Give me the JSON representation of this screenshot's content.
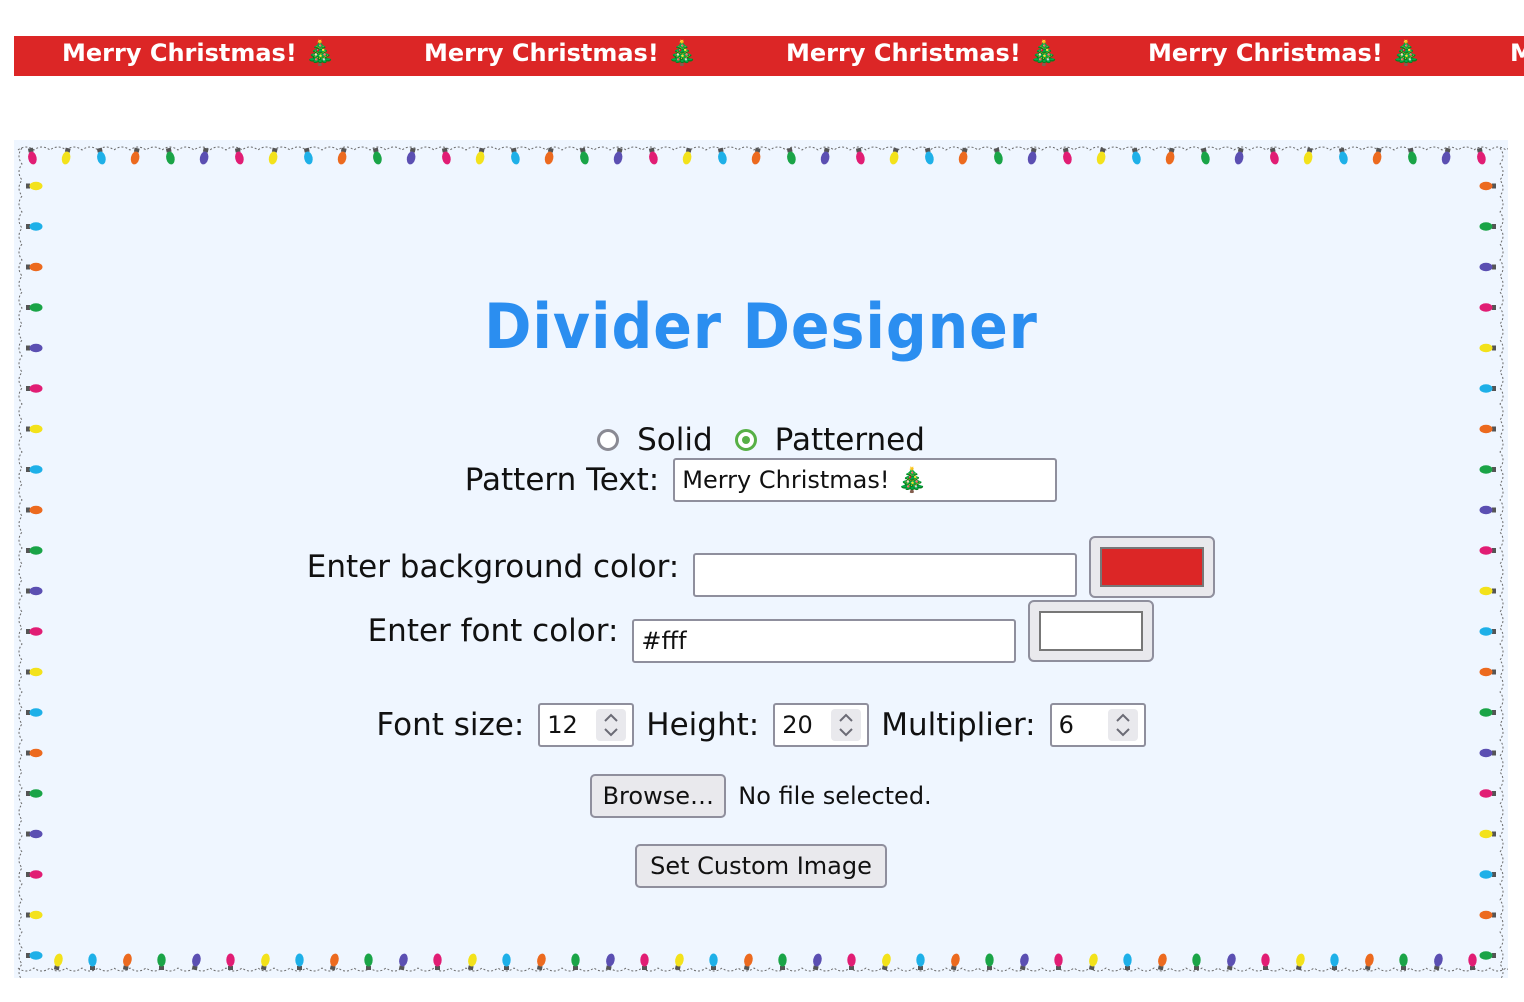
{
  "banner": {
    "text": "Merry Christmas! 🎄",
    "background_color": "#dc2626",
    "text_color": "#ffffff"
  },
  "page": {
    "title": "Divider Designer",
    "title_color": "#2b8ef0",
    "frame_background": "#eff6ff"
  },
  "mode": {
    "options": [
      {
        "label": "Solid",
        "checked": false
      },
      {
        "label": "Patterned",
        "checked": true
      }
    ]
  },
  "pattern": {
    "label": "Pattern Text:",
    "value": "Merry Christmas! 🎄"
  },
  "background_color": {
    "label": "Enter background color:",
    "value": "",
    "swatch": "#dc2626"
  },
  "font_color": {
    "label": "Enter font color:",
    "value": "#fff",
    "swatch": "#ffffff"
  },
  "font_size": {
    "label": "Font size:",
    "value": "12"
  },
  "height": {
    "label": "Height:",
    "value": "20"
  },
  "multiplier": {
    "label": "Multiplier:",
    "value": "6"
  },
  "file": {
    "browse_label": "Browse…",
    "status": "No file selected."
  },
  "set_image": {
    "label": "Set Custom Image"
  },
  "lights": {
    "colors": [
      "#e11d74",
      "#f3e21b",
      "#1eb0e8",
      "#ec6a1f",
      "#1aa447",
      "#5b4fb2"
    ]
  }
}
